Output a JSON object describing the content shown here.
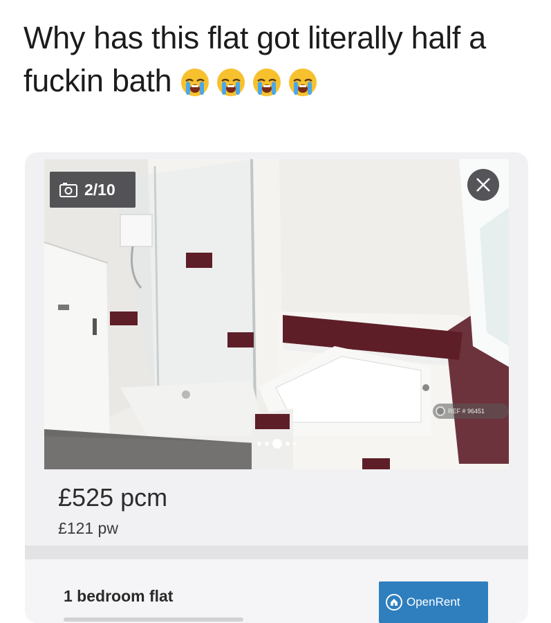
{
  "caption": {
    "text": "Why has this flat got literally half a fuckin bath",
    "emojis": [
      "loudly-crying-face-icon",
      "loudly-crying-face-icon",
      "loudly-crying-face-icon",
      "loudly-crying-face-icon"
    ]
  },
  "listing": {
    "photo_counter": "2/10",
    "ref_watermark": "REF # 96451",
    "price_monthly": "£525 pcm",
    "price_weekly": "£121 pw",
    "property_type": "1 bedroom flat",
    "agent_name": "OpenRent",
    "carousel_dots": 5,
    "active_dot": 2
  },
  "colors": {
    "agent_brand": "#2f7fbf",
    "card_background": "#f1f1f3",
    "accent_tile": "#5e1e28"
  }
}
